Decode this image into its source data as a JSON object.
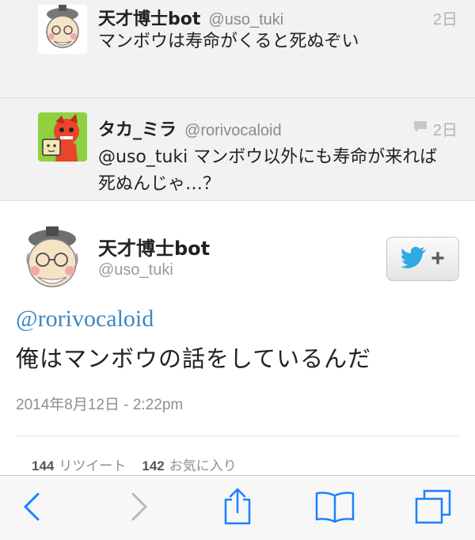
{
  "thread": {
    "replies": [
      {
        "display_name": "天才博士bot",
        "handle": "@uso_tuki",
        "time": "2日",
        "text": "マンボウは寿命がくると死ぬぞい"
      },
      {
        "display_name": "タカ_ミラ",
        "handle": "@rorivocaloid",
        "time": "2日",
        "text": "@uso_tuki マンボウ以外にも寿命が来れば死ぬんじゃ…？"
      }
    ]
  },
  "tweet": {
    "display_name": "天才博士bot",
    "handle": "@uso_tuki",
    "mention": "@rorivocaloid",
    "body": "俺はマンボウの話をしているんだ",
    "timestamp": "2014年8月12日 - 2:22pm",
    "retweet_count": "144",
    "retweet_label": "リツイート",
    "favorite_count": "142",
    "favorite_label": "お気に入り",
    "follow_icon": "twitter-bird-icon"
  },
  "toolbar": {
    "icons": [
      "back-icon",
      "forward-icon",
      "share-icon",
      "bookmarks-icon",
      "tabs-icon"
    ]
  },
  "colors": {
    "link": "#3b88c3",
    "toolbar_icon": "#1a82fb",
    "toolbar_icon_disabled": "#b8b8b8",
    "twitter_blue": "#2fa8e6"
  }
}
